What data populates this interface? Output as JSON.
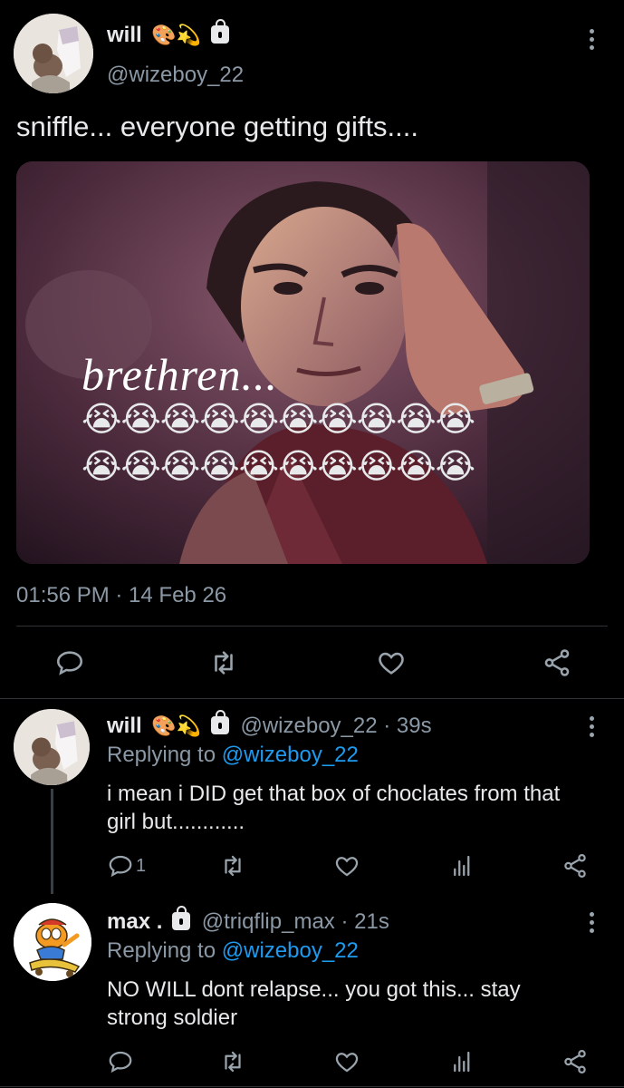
{
  "main_tweet": {
    "display_name": "will",
    "badges": "🎨💫",
    "handle": "@wizeboy_22",
    "text": "sniffle... everyone getting gifts....",
    "image_caption": "brethren...",
    "image_emoji_rows": [
      "😭😭😭😭😭😭😭😭😭😭",
      "😭😭😭😭😭😭😭😭😭😭"
    ],
    "timestamp": "01:56 PM · 14 Feb 26"
  },
  "replies": [
    {
      "display_name": "will",
      "badges": "🎨💫",
      "handle_time": "@wizeboy_22 · 39s",
      "replying_prefix": "Replying to",
      "replying_handle": "@wizeboy_22",
      "text": "i mean i DID get that box of choclates from that girl but............",
      "reply_count": "1"
    },
    {
      "display_name": "max .",
      "handle_time": "@triqflip_max · 21s",
      "replying_prefix": "Replying to",
      "replying_handle": "@wizeboy_22",
      "text": "NO WILL dont relapse... you got this... stay strong soldier"
    }
  ],
  "colors": {
    "background": "#000000",
    "text": "#e7e9ea",
    "muted": "#8b98a5",
    "link": "#1d9bf0"
  },
  "icons": [
    "reply-icon",
    "retweet-icon",
    "like-icon",
    "share-icon",
    "analytics-icon",
    "lock-icon",
    "more-icon"
  ]
}
